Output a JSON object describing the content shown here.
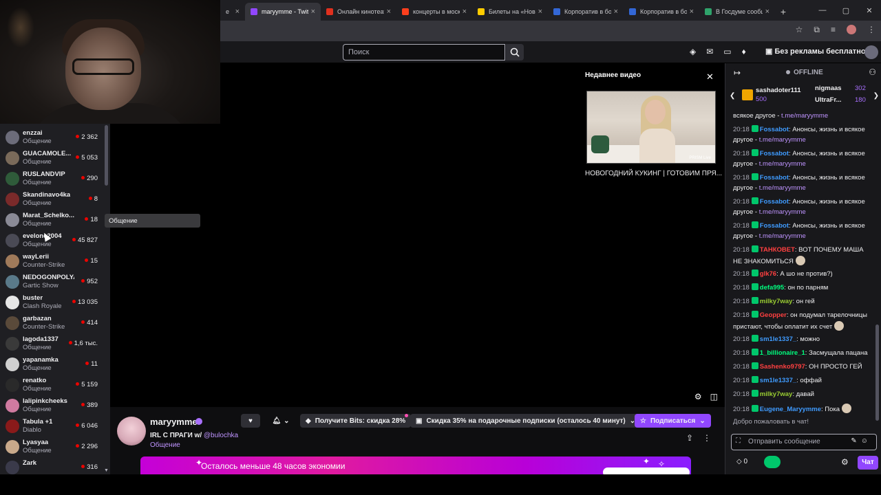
{
  "browser": {
    "tabs": [
      {
        "label": "е",
        "color": "#444",
        "active": false
      },
      {
        "label": "maryymme - Twit",
        "color": "#9147ff",
        "active": true
      },
      {
        "label": "Онлайн кинотеат",
        "color": "#e0301e",
        "active": false
      },
      {
        "label": "концерты в моск",
        "color": "#fc3f1d",
        "active": false
      },
      {
        "label": "Билеты на «Нов",
        "color": "#ffcc00",
        "active": false
      },
      {
        "label": "Корпоратив в бо",
        "color": "#3367d6",
        "active": false
      },
      {
        "label": "Корпоратив в бо",
        "color": "#3367d6",
        "active": false
      },
      {
        "label": "В Госдуме сообщ",
        "color": "#2fa36b",
        "active": false
      }
    ],
    "new_tab": "+",
    "window_controls": [
      "—",
      "▢",
      "✕"
    ]
  },
  "topnav": {
    "search_placeholder": "Поиск",
    "adfree_label": "Без рекламы бесплатно"
  },
  "sidebar": {
    "channels": [
      {
        "name": "enzzai",
        "game": "Общение",
        "viewers": "2 362",
        "color": "#6c6c7a"
      },
      {
        "name": "GUACAMOLE...",
        "game": "Общение",
        "viewers": "5 053",
        "color": "#7a6a5a"
      },
      {
        "name": "RUSLANDVIP",
        "game": "Общение",
        "viewers": "290",
        "color": "#2f5b3a"
      },
      {
        "name": "Skandinavo4ka",
        "game": "Общение",
        "viewers": "8",
        "color": "#7a2a2a"
      },
      {
        "name": "Marat_Schelko...",
        "game": "Общение",
        "viewers": "18",
        "color": "#8a8a96"
      },
      {
        "name": "evelone2004",
        "game": "Общение",
        "viewers": "45 827",
        "color": "#4a4a55"
      },
      {
        "name": "wayLerii",
        "game": "Counter-Strike",
        "viewers": "15",
        "color": "#a07a5a"
      },
      {
        "name": "NEDOGONPOLYA",
        "game": "Gartic Show",
        "viewers": "952",
        "color": "#5a7a8a"
      },
      {
        "name": "buster",
        "game": "Clash Royale",
        "viewers": "13 035",
        "color": "#e6e6e6"
      },
      {
        "name": "garbazan",
        "game": "Counter-Strike",
        "viewers": "414",
        "color": "#5a4a3a"
      },
      {
        "name": "lagoda1337",
        "game": "Общение",
        "viewers": "1,6 тыс.",
        "color": "#3a3a3a"
      },
      {
        "name": "yapanamka",
        "game": "Общение",
        "viewers": "11",
        "color": "#d0d0d0"
      },
      {
        "name": "renatko",
        "game": "Общение",
        "viewers": "5 159",
        "color": "#2a2a2a"
      },
      {
        "name": "lalipinkcheeks",
        "game": "Общение",
        "viewers": "389",
        "color": "#d07aa0"
      },
      {
        "name": "Tabula +1",
        "game": "Diablo",
        "viewers": "6 046",
        "color": "#8a1a1a"
      },
      {
        "name": "Lyasyaa",
        "game": "Общение",
        "viewers": "2 296",
        "color": "#c9a98a"
      },
      {
        "name": "Zark",
        "game": "",
        "viewers": "316",
        "color": "#3a3a4a"
      }
    ],
    "tooltip": "Общение"
  },
  "player": {
    "recent_title": "Недавнее видео",
    "recent_caption": "НОВОГОДНИЙ КУКИНГ | ГОТОВИМ ПРЯ...",
    "thumb_watermark": "PRISM Live"
  },
  "stream": {
    "name": "maryymme",
    "title": "IRL С ПРАГИ w/",
    "mention": "@bulochka",
    "category": "Общение",
    "bits_label": "Получите Bits: скидка 28%",
    "gift_label": "Скидка 35% на подарочные подписки (осталось 40 минут)",
    "sub_label": "Подписаться",
    "banner_text": "Осталось меньше 48 часов экономии"
  },
  "chat": {
    "status": "OFFLINE",
    "leaders": {
      "first_name": "sashadoter111",
      "first_score": "500",
      "second_name": "nigmaas",
      "second_score": "302",
      "third_name": "UltraFr...",
      "third_score": "180"
    },
    "messages": [
      {
        "time": "",
        "user": "",
        "ucolor": "#efeff1",
        "text": "всякое другое - ",
        "link": "t.me/maryymme"
      },
      {
        "time": "20:18",
        "user": "Fossabot",
        "ucolor": "#3f9bff",
        "text": ": Анонсы, жизнь и всякое другое - ",
        "link": "t.me/maryymme"
      },
      {
        "time": "20:18",
        "user": "Fossabot",
        "ucolor": "#3f9bff",
        "text": ": Анонсы, жизнь и всякое другое - ",
        "link": "t.me/maryymme"
      },
      {
        "time": "20:18",
        "user": "Fossabot",
        "ucolor": "#3f9bff",
        "text": ": Анонсы, жизнь и всякое другое - ",
        "link": "t.me/maryymme"
      },
      {
        "time": "20:18",
        "user": "Fossabot",
        "ucolor": "#3f9bff",
        "text": ": Анонсы, жизнь и всякое другое - ",
        "link": "t.me/maryymme"
      },
      {
        "time": "20:18",
        "user": "Fossabot",
        "ucolor": "#3f9bff",
        "text": ": Анонсы, жизнь и всякое другое - ",
        "link": "t.me/maryymme"
      },
      {
        "time": "20:18",
        "user": "ТАНКОВЕТ",
        "ucolor": "#ff4040",
        "text": ": ВОТ ПОЧЕМУ МАША НЕ ЗНАКОМИТЬСЯ",
        "link": ""
      },
      {
        "time": "20:18",
        "user": "glk76",
        "ucolor": "#ff4040",
        "text": ": А шо не против?)",
        "link": ""
      },
      {
        "time": "20:18",
        "user": "defa995",
        "ucolor": "#00ff7f",
        "text": ": он по парням",
        "link": ""
      },
      {
        "time": "20:18",
        "user": "milky7way",
        "ucolor": "#9acd32",
        "text": ": он гей",
        "link": ""
      },
      {
        "time": "20:18",
        "user": "Geopper",
        "ucolor": "#ff4040",
        "text": ": он подумал тарелочницы пристают, чтобы оплатит их счет",
        "link": ""
      },
      {
        "time": "20:18",
        "user": "sm1le1337_",
        "ucolor": "#3f9bff",
        "text": ": можно",
        "link": ""
      },
      {
        "time": "20:18",
        "user": "1_billionaire_1",
        "ucolor": "#00ff7f",
        "text": ": Засмущала пацана",
        "link": ""
      },
      {
        "time": "20:18",
        "user": "Sashenko9797",
        "ucolor": "#ff4040",
        "text": ": ОН ПРОСТО ГЕЙ",
        "link": ""
      },
      {
        "time": "20:18",
        "user": "sm1le1337_",
        "ucolor": "#3f9bff",
        "text": ": оффай",
        "link": ""
      },
      {
        "time": "20:18",
        "user": "milky7way",
        "ucolor": "#9acd32",
        "text": ": давай",
        "link": ""
      },
      {
        "time": "20:18",
        "user": "Eugene_Maryymme",
        "ucolor": "#3f9bff",
        "text": ": Пока",
        "link": ""
      }
    ],
    "welcome": "Добро пожаловать в чат!",
    "input_placeholder": "Отправить сообщение",
    "points": "0",
    "send_label": "Чат"
  }
}
